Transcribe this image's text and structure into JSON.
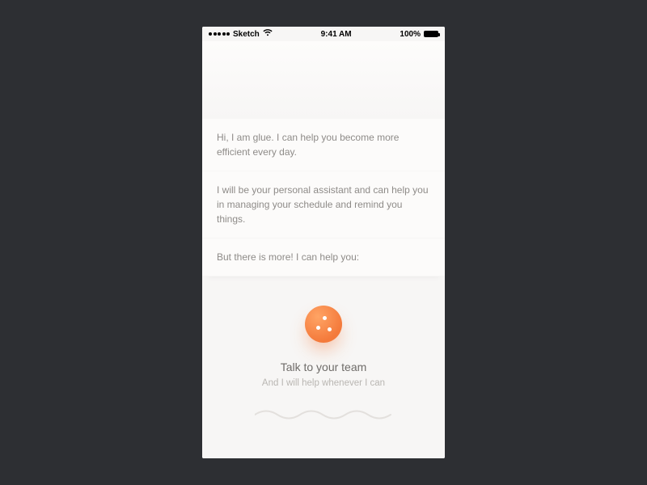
{
  "statusbar": {
    "carrier": "Sketch",
    "time": "9:41 AM",
    "battery": "100%"
  },
  "messages": [
    "Hi, I am glue. I can help you become more efficient every day.",
    "I will be your personal assistant and can help you in managing your schedule and remind you things.",
    "But there is more! I can help you:"
  ],
  "feature": {
    "title": "Talk to your team",
    "subtitle": "And I will help whenever I can"
  }
}
